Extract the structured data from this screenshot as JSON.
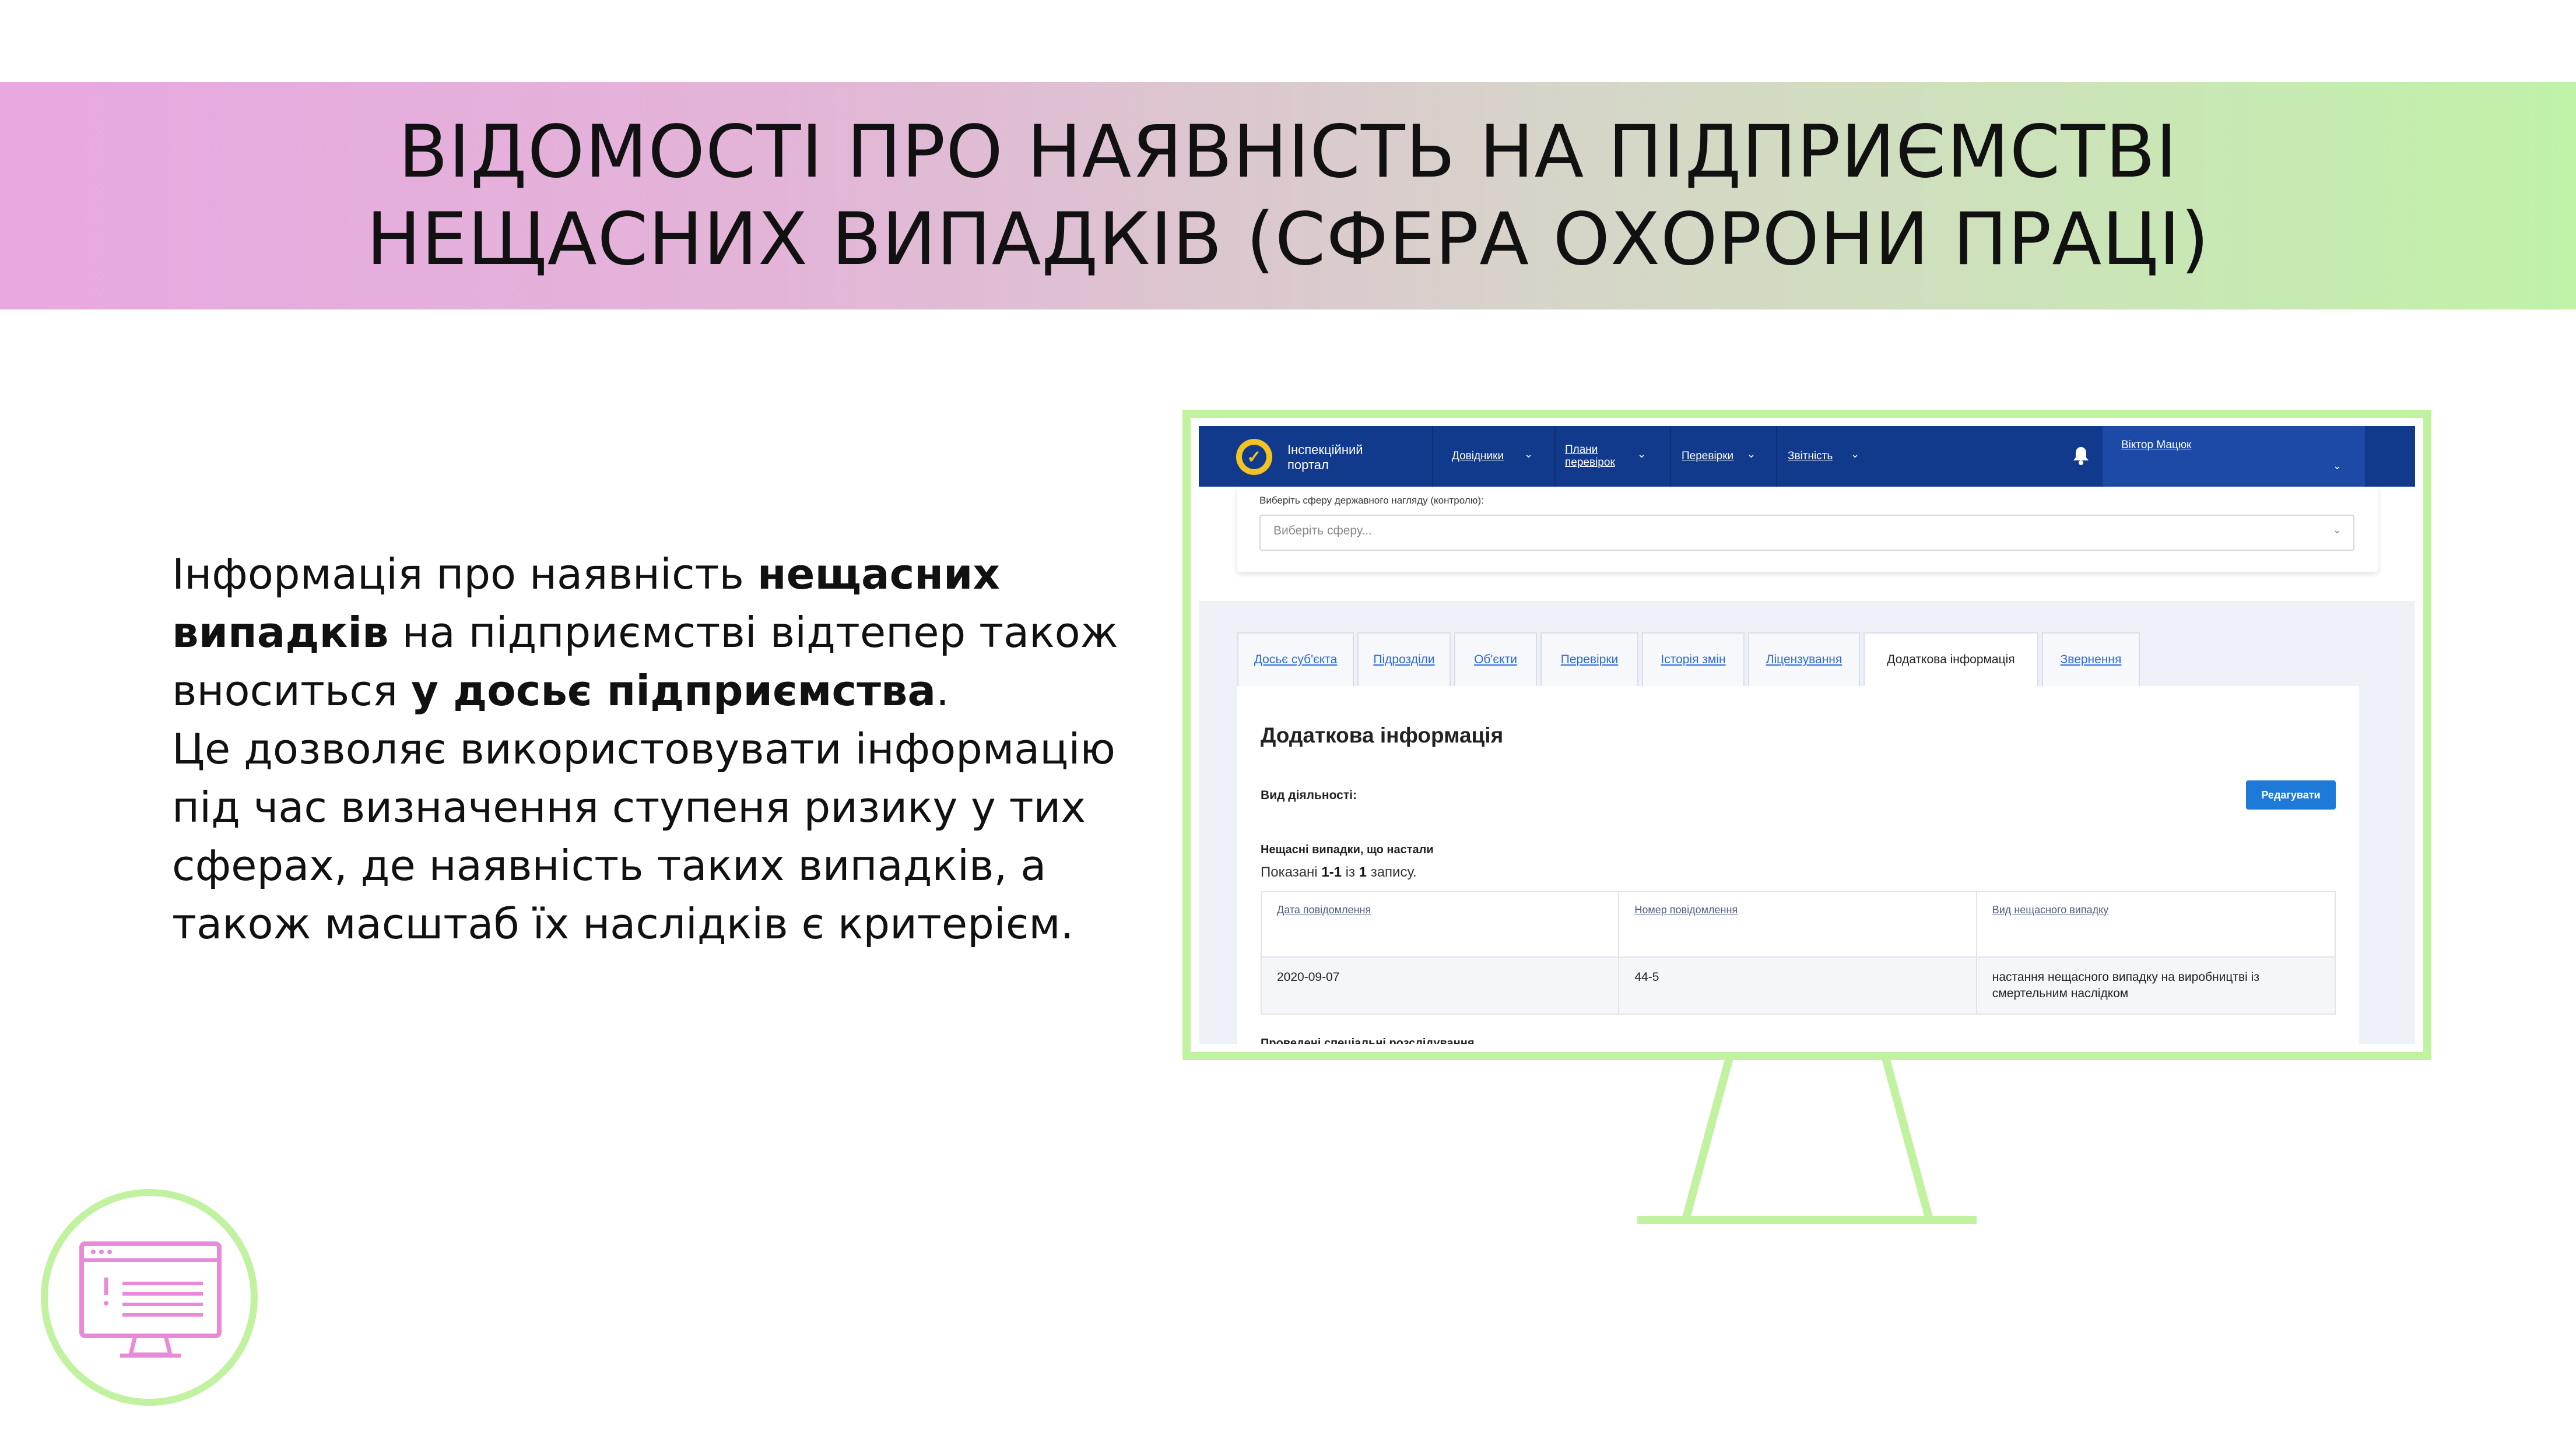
{
  "slide": {
    "title_line1": "ВІДОМОСТІ ПРО НАЯВНІСТЬ НА ПІДПРИЄМСТВІ",
    "title_line2": "НЕЩАСНИХ ВИПАДКІВ (СФЕРА ОХОРОНИ ПРАЦІ)",
    "paragraph": {
      "p1": "Інформація про наявність ",
      "b1": "нещасних випадків",
      "p2": " на підприємстві відтепер також вноситься ",
      "b2": "у досьє підприємства",
      "p3": ".",
      "p4": "Це дозволяє використовувати інформацію під час визначення ступеня ризику у тих сферах, де наявність таких випадків, а також масштаб їх наслідків є критерієм."
    }
  },
  "portal": {
    "brand": "Інспекційний портал",
    "nav": {
      "item1": "Довідники",
      "item2": "Плани перевірок",
      "item3": "Перевірки",
      "item4": "Звітність"
    },
    "user_name": "Віктор Мацюк",
    "sphere": {
      "label": "Виберіть сферу державного нагляду (контролю):",
      "placeholder": "Виберіть сферу..."
    },
    "tabs": [
      "Досьє суб'єкта",
      "Підрозділи",
      "Об'єкти",
      "Перевірки",
      "Історія змін",
      "Ліцензування",
      "Додаткова інформація",
      "Звернення"
    ],
    "active_tab": "Додаткова інформація",
    "panel": {
      "title": "Додаткова інформація",
      "activity_label": "Вид діяльності:",
      "edit_button": "Редагувати",
      "accidents_label": "Нещасні випадки, що настали",
      "shown_prefix": "Показані ",
      "shown_range": "1-1",
      "shown_mid": " із ",
      "shown_total": "1",
      "shown_suffix": " запису.",
      "table": {
        "headers": [
          "Дата повідомлення",
          "Номер повідомлення",
          "Вид нещасного випадку"
        ],
        "rows": [
          [
            "2020-09-07",
            "44-5",
            "настання нещасного випадку на виробництві із смертельним наслідком"
          ]
        ]
      },
      "next_section_label": "Проведені спеціальні розслідування"
    }
  },
  "colors": {
    "band_left": "#e8a8e0",
    "band_right": "#c0f2a8",
    "monitor": "#c0f2a0",
    "navbar": "#123a8c",
    "button": "#1e7ad8",
    "icon_pink": "#e88ad8"
  },
  "icons": {
    "logo": "check-circle-icon",
    "bell": "bell-icon",
    "computer": "computer-monitor-icon"
  }
}
